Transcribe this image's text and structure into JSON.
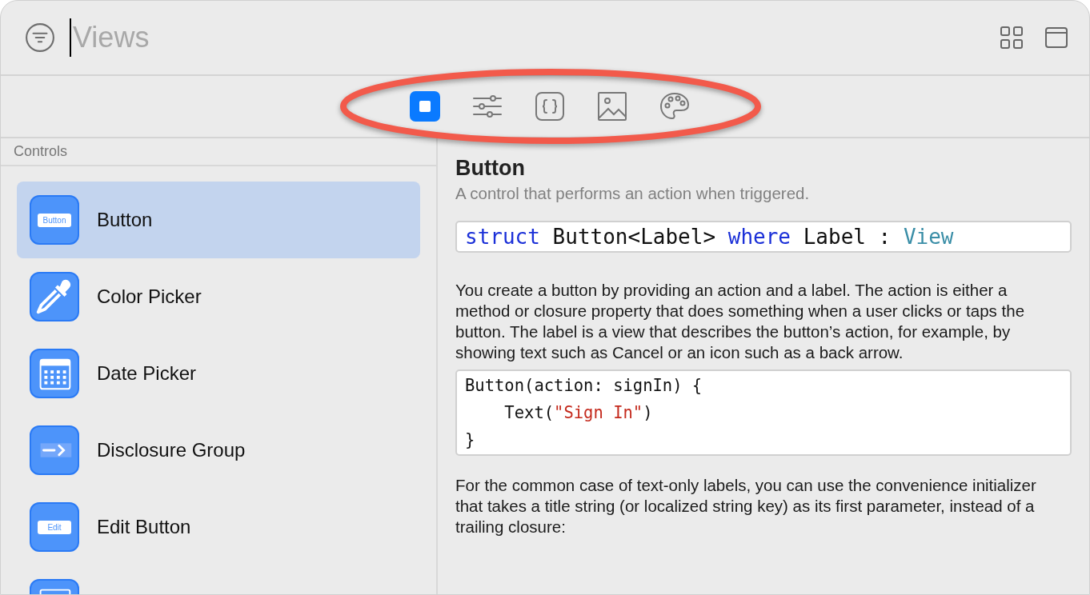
{
  "search": {
    "placeholder": "Views"
  },
  "toolbar": {
    "highlighted": true,
    "tabs": [
      {
        "kind": "square",
        "selected": true
      },
      {
        "kind": "sliders",
        "selected": false
      },
      {
        "kind": "braces",
        "selected": false
      },
      {
        "kind": "photo",
        "selected": false
      },
      {
        "kind": "palette",
        "selected": false
      }
    ]
  },
  "sidebar": {
    "section": "Controls",
    "items": [
      {
        "kind": "button",
        "icon_label": "Button",
        "label": "Button",
        "selected": true
      },
      {
        "kind": "dropper",
        "label": "Color Picker",
        "selected": false
      },
      {
        "kind": "calendar",
        "label": "Date Picker",
        "selected": false
      },
      {
        "kind": "disclosure",
        "label": "Disclosure Group",
        "selected": false
      },
      {
        "kind": "button",
        "icon_label": "Edit",
        "label": "Edit Button",
        "selected": false
      },
      {
        "kind": "window",
        "selected": false
      }
    ]
  },
  "detail": {
    "title": "Button",
    "subtitle": "A control that performs an action when triggered.",
    "declaration": [
      {
        "kind": "keyword",
        "text": "struct"
      },
      {
        "kind": "plain",
        "text": " Button<Label> "
      },
      {
        "kind": "keyword",
        "text": "where"
      },
      {
        "kind": "plain",
        "text": " Label : "
      },
      {
        "kind": "type",
        "text": "View"
      }
    ],
    "paragraph_1": "You create a button by providing an action and a label. The action is either a method or closure property that does something when a user clicks or taps the button. The label is a view that describes the button’s action, for example, by showing text such as Cancel or an icon such as a back arrow.",
    "example": [
      [
        {
          "kind": "plain",
          "text": "Button(action: signIn) {"
        }
      ],
      [
        {
          "kind": "plain",
          "text": "    Text("
        },
        {
          "kind": "string",
          "text": "\"Sign In\""
        },
        {
          "kind": "plain",
          "text": ")"
        }
      ],
      [
        {
          "kind": "plain",
          "text": "}"
        }
      ]
    ],
    "paragraph_2": "For the common case of text-only labels, you can use the convenience initializer that takes a title string (or localized string key) as its first parameter, instead of a trailing closure:"
  }
}
